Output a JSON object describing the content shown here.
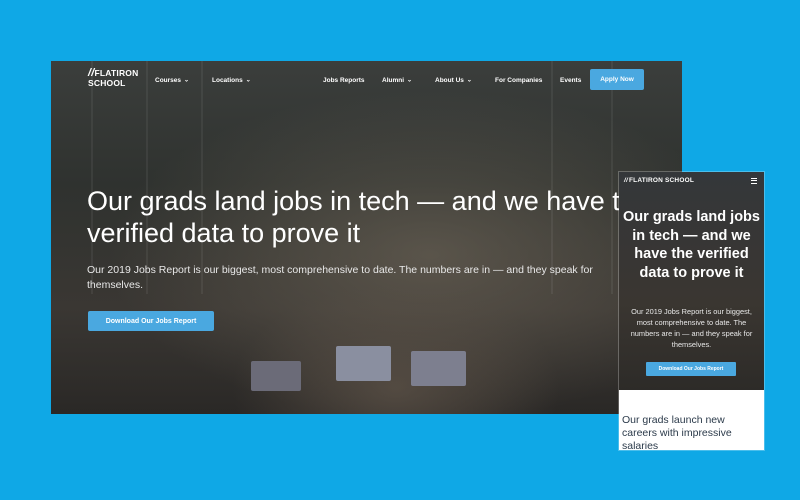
{
  "brand": {
    "logo_slashes": "//",
    "logo_line1": "FLATIRON",
    "logo_line2": "SCHOOL",
    "logo_inline": "FLATIRON SCHOOL"
  },
  "desktop": {
    "nav": {
      "courses": "Courses",
      "locations": "Locations",
      "jobs_reports": "Jobs Reports",
      "alumni": "Alumni",
      "about_us": "About Us",
      "for_companies": "For Companies",
      "events": "Events",
      "apply_now": "Apply Now",
      "chevron": "⌄"
    },
    "hero": {
      "headline": "Our grads land jobs in tech — and we have the verified data to prove it",
      "subtext": "Our 2019 Jobs Report is our biggest, most comprehensive to date. The numbers are in — and they speak for themselves.",
      "cta": "Download Our Jobs Report"
    }
  },
  "mobile": {
    "hero": {
      "headline": "Our grads land jobs in tech — and we have the verified data to prove it",
      "subtext": "Our 2019 Jobs Report is our biggest, most comprehensive to date. The numbers are in — and they speak for themselves.",
      "cta": "Download Our Jobs Report"
    },
    "below_text": "Our grads launch new careers with impressive salaries"
  },
  "colors": {
    "background": "#0fa8e6",
    "accent": "#4aa8e0"
  },
  "icons": {
    "menu": "hamburger-menu-icon",
    "dropdown": "chevron-down-icon"
  }
}
